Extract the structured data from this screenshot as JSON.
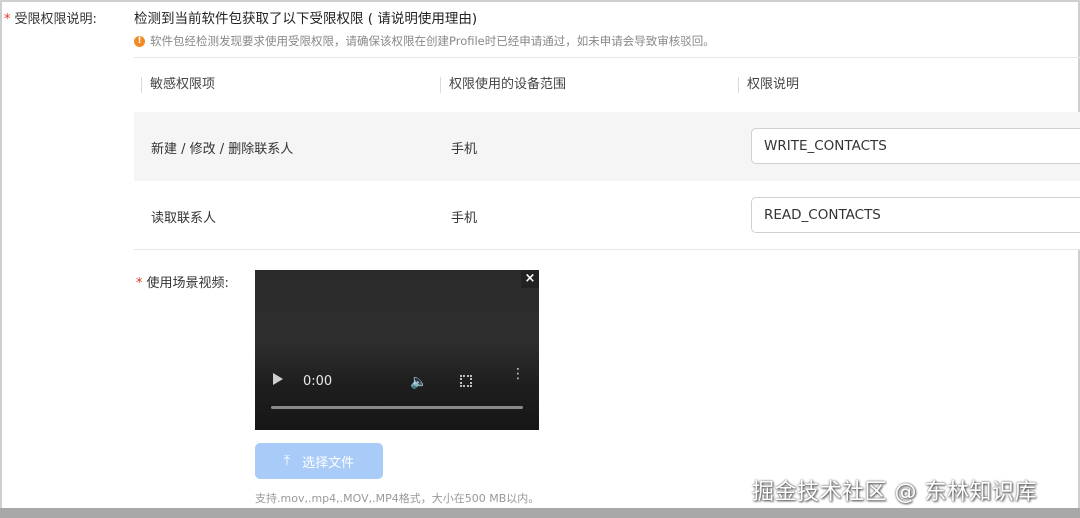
{
  "field": {
    "label": "受限权限说明:",
    "required": "*"
  },
  "headline": "检测到当前软件包获取了以下受限权限 ( 请说明使用理由)",
  "warning": {
    "icon": "warning-icon",
    "text": "软件包经检测发现要求使用受限权限，请确保该权限在创建Profile时已经申请通过，如未申请会导致审核驳回。",
    "color": "#f08a24"
  },
  "table": {
    "headers": [
      "敏感权限项",
      "权限使用的设备范围",
      "权限说明"
    ],
    "rows": [
      {
        "item": "新建 / 修改 / 删除联系人",
        "scope": "手机",
        "explanation": "WRITE_CONTACTS"
      },
      {
        "item": "读取联系人",
        "scope": "手机",
        "explanation": "READ_CONTACTS"
      }
    ]
  },
  "video": {
    "label": "使用场景视频:",
    "required": "*",
    "time": "0:00",
    "close": "×"
  },
  "upload": {
    "button_label": "选择文件",
    "hint": "支持.mov,.mp4,.MOV,.MP4格式，大小在500 MB以内。",
    "button_color": "#a9cbf7"
  },
  "watermark": "掘金技术社区 @ 东林知识库"
}
